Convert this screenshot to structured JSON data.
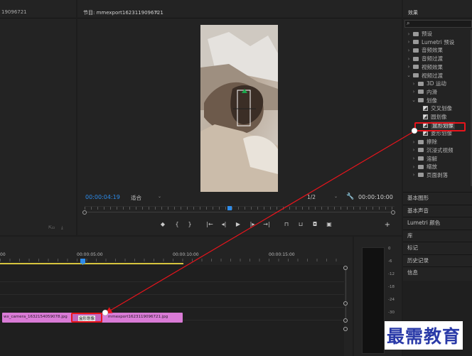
{
  "project_panel": {
    "title": "19096721"
  },
  "program_monitor": {
    "title": "节目: mmexport1623119096721",
    "menu_icon": "≡",
    "timecode_current": "00:00:04:19",
    "zoom": "适合",
    "resolution": "1/2",
    "timecode_total": "00:00:10:00"
  },
  "effects_panel": {
    "title": "效果",
    "search_placeholder": "",
    "tree": [
      {
        "label": "预设",
        "level": 0,
        "expanded": false
      },
      {
        "label": "Lumetri 预设",
        "level": 0,
        "expanded": false
      },
      {
        "label": "音频效果",
        "level": 0,
        "expanded": false
      },
      {
        "label": "音频过渡",
        "level": 0,
        "expanded": false
      },
      {
        "label": "视频效果",
        "level": 0,
        "expanded": false
      },
      {
        "label": "视频过渡",
        "level": 0,
        "expanded": true
      },
      {
        "label": "3D 运动",
        "level": 1,
        "expanded": false
      },
      {
        "label": "内滑",
        "level": 1,
        "expanded": false
      },
      {
        "label": "划像",
        "level": 1,
        "expanded": true
      },
      {
        "label": "交叉划像",
        "level": 2,
        "item": true
      },
      {
        "label": "圆划像",
        "level": 2,
        "item": true
      },
      {
        "label": "盒形划像",
        "level": 2,
        "item": true,
        "selected": true
      },
      {
        "label": "菱形划像",
        "level": 2,
        "item": true
      },
      {
        "label": "擦除",
        "level": 1,
        "expanded": false
      },
      {
        "label": "沉浸式视频",
        "level": 1,
        "expanded": false
      },
      {
        "label": "溶解",
        "level": 1,
        "expanded": false
      },
      {
        "label": "缩放",
        "level": 1,
        "expanded": false
      },
      {
        "label": "页面剥落",
        "level": 1,
        "expanded": false
      }
    ],
    "sections": [
      "基本图形",
      "基本声音",
      "Lumetri 颜色",
      "库",
      "标记",
      "历史记录",
      "信息"
    ]
  },
  "timeline": {
    "ruler": [
      "00",
      "00:00:05:00",
      "00:00:10:00",
      "00:00:15:00"
    ],
    "clips": [
      {
        "label": "wx_camera_1632154059078.jpg"
      },
      {
        "label": "mmexport1623119096721.jpg"
      }
    ],
    "transition_label": "盒形划像"
  },
  "audio_meter": {
    "scale": [
      "0",
      "-6",
      "-12",
      "-18",
      "-24",
      "-30"
    ]
  },
  "watermark": {
    "text": "最需教育"
  },
  "colors": {
    "accent": "#2d8ceb",
    "clip": "#d97bd6",
    "highlight": "#e8141c",
    "playhead": "#2d8ceb"
  }
}
